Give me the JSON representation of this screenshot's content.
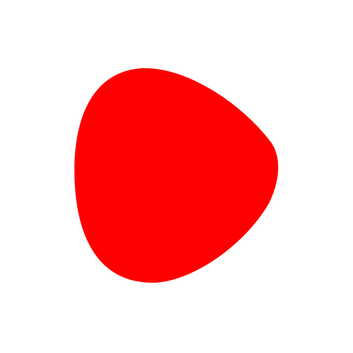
{
  "icon": {
    "name": "play-icon",
    "color": "#ff0000",
    "background": "#ffffff"
  }
}
